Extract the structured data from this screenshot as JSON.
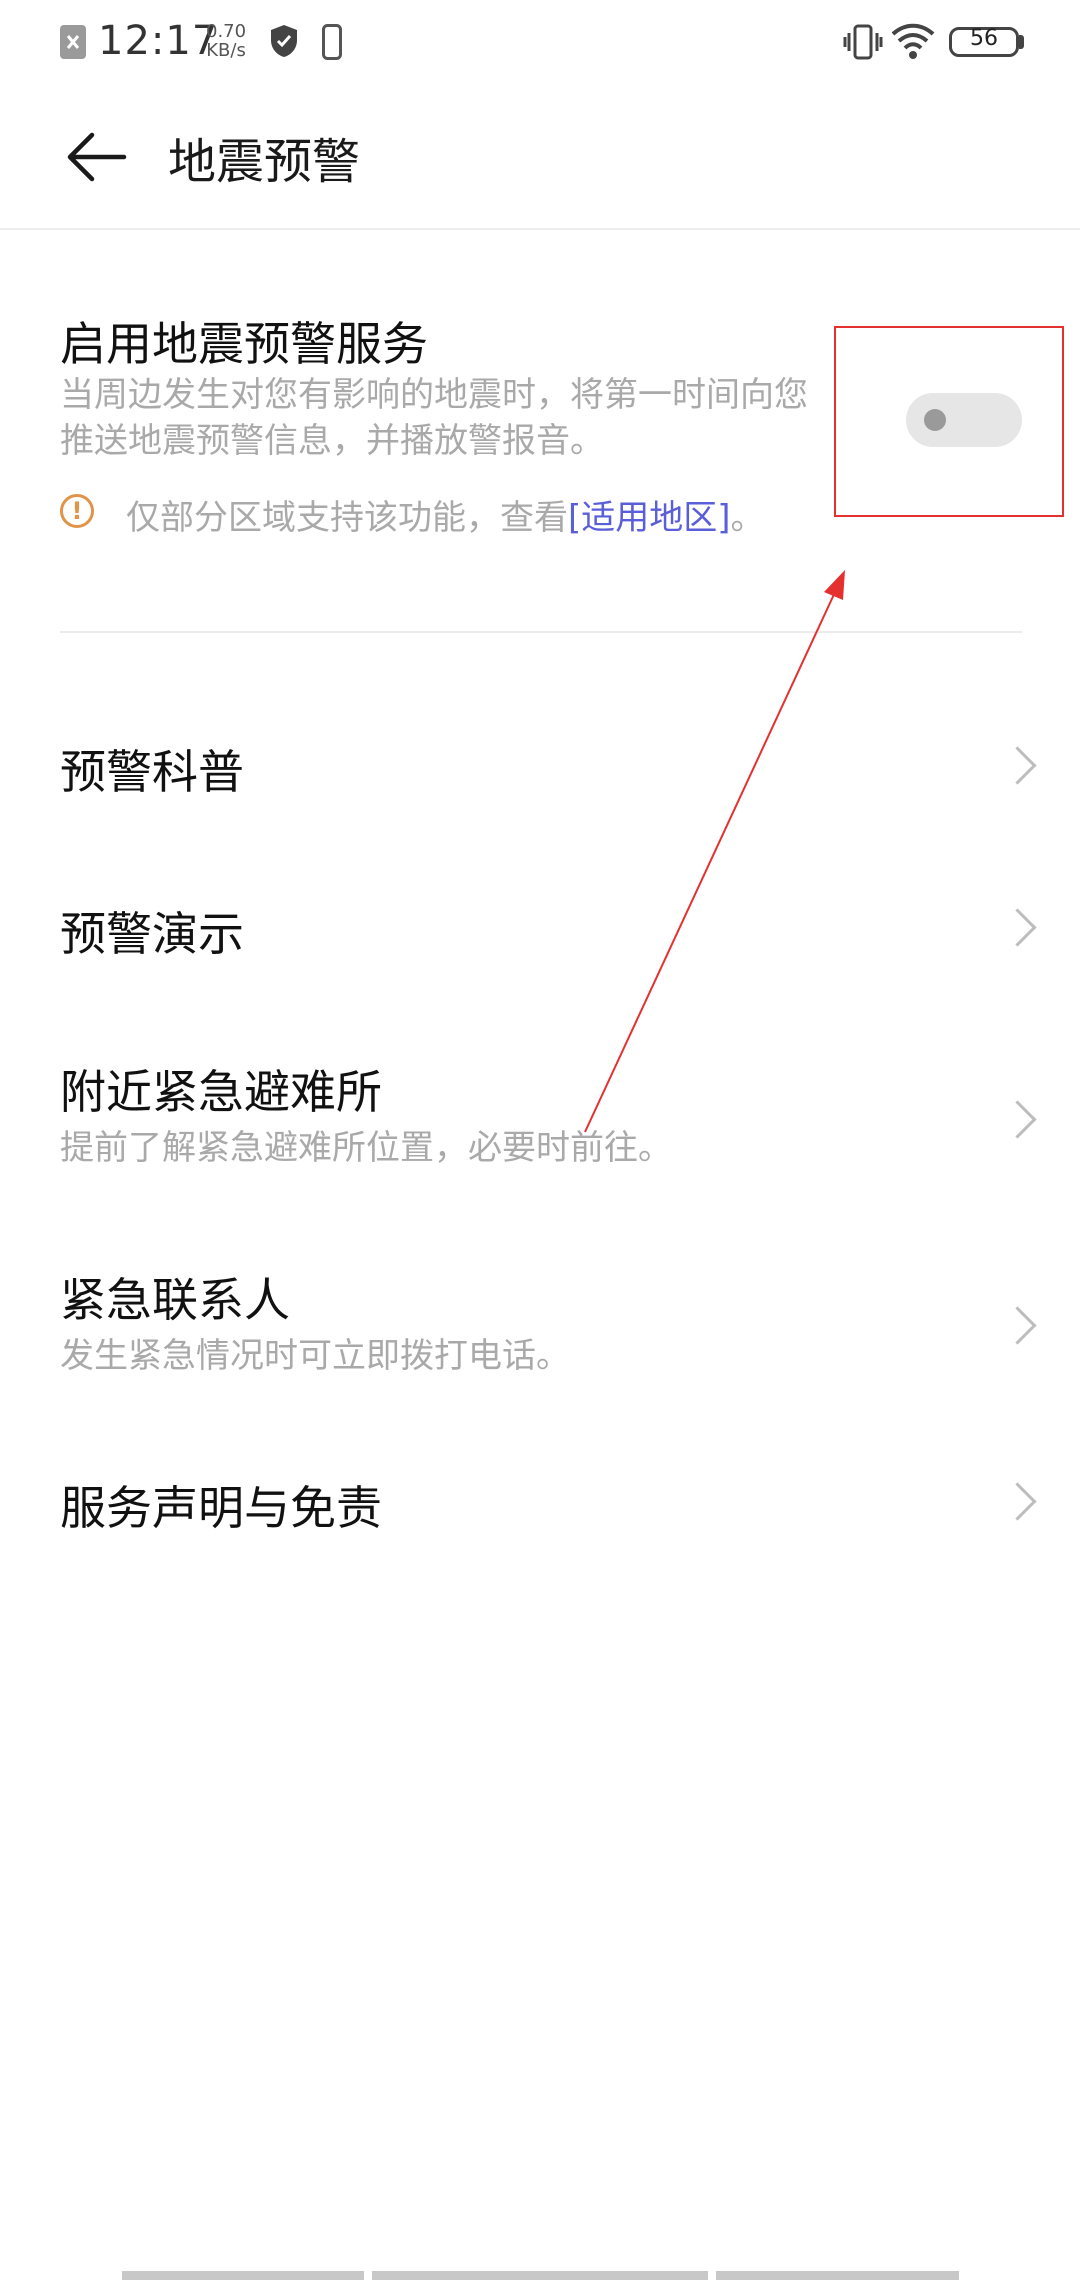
{
  "status_bar": {
    "time": "12:17",
    "speed_value": "0.70",
    "speed_unit": "KB/s",
    "battery": "56"
  },
  "header": {
    "title": "地震预警"
  },
  "enable_service": {
    "title": "启用地震预警服务",
    "description": "当周边发生对您有影响的地震时，将第一时间向您推送地震预警信息，并播放警报音。",
    "note_text": "仅部分区域支持该功能，查看",
    "note_link": "[适用地区]",
    "note_end": "。",
    "toggle_on": false
  },
  "list_items": [
    {
      "title": "预警科普",
      "subtitle": ""
    },
    {
      "title": "预警演示",
      "subtitle": ""
    },
    {
      "title": "附近紧急避难所",
      "subtitle": "提前了解紧急避难所位置，必要时前往。"
    },
    {
      "title": "紧急联系人",
      "subtitle": "发生紧急情况时可立即拨打电话。"
    },
    {
      "title": "服务声明与免责",
      "subtitle": ""
    }
  ],
  "colors": {
    "link": "#5a5ed9",
    "warning": "#e0944a",
    "annotation": "#e53030"
  }
}
